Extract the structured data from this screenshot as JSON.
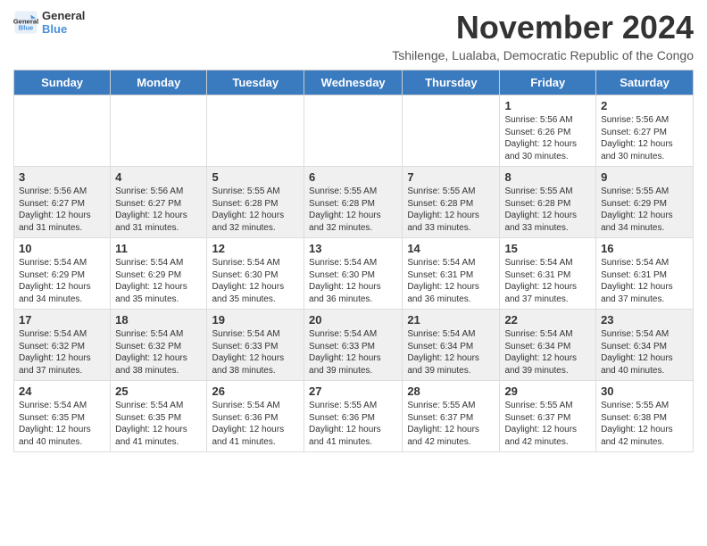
{
  "header": {
    "logo_line1": "General",
    "logo_line2": "Blue",
    "month_title": "November 2024",
    "subtitle": "Tshilenge, Lualaba, Democratic Republic of the Congo"
  },
  "days_of_week": [
    "Sunday",
    "Monday",
    "Tuesday",
    "Wednesday",
    "Thursday",
    "Friday",
    "Saturday"
  ],
  "weeks": [
    [
      {
        "day": "",
        "info": ""
      },
      {
        "day": "",
        "info": ""
      },
      {
        "day": "",
        "info": ""
      },
      {
        "day": "",
        "info": ""
      },
      {
        "day": "",
        "info": ""
      },
      {
        "day": "1",
        "info": "Sunrise: 5:56 AM\nSunset: 6:26 PM\nDaylight: 12 hours and 30 minutes."
      },
      {
        "day": "2",
        "info": "Sunrise: 5:56 AM\nSunset: 6:27 PM\nDaylight: 12 hours and 30 minutes."
      }
    ],
    [
      {
        "day": "3",
        "info": "Sunrise: 5:56 AM\nSunset: 6:27 PM\nDaylight: 12 hours and 31 minutes."
      },
      {
        "day": "4",
        "info": "Sunrise: 5:56 AM\nSunset: 6:27 PM\nDaylight: 12 hours and 31 minutes."
      },
      {
        "day": "5",
        "info": "Sunrise: 5:55 AM\nSunset: 6:28 PM\nDaylight: 12 hours and 32 minutes."
      },
      {
        "day": "6",
        "info": "Sunrise: 5:55 AM\nSunset: 6:28 PM\nDaylight: 12 hours and 32 minutes."
      },
      {
        "day": "7",
        "info": "Sunrise: 5:55 AM\nSunset: 6:28 PM\nDaylight: 12 hours and 33 minutes."
      },
      {
        "day": "8",
        "info": "Sunrise: 5:55 AM\nSunset: 6:28 PM\nDaylight: 12 hours and 33 minutes."
      },
      {
        "day": "9",
        "info": "Sunrise: 5:55 AM\nSunset: 6:29 PM\nDaylight: 12 hours and 34 minutes."
      }
    ],
    [
      {
        "day": "10",
        "info": "Sunrise: 5:54 AM\nSunset: 6:29 PM\nDaylight: 12 hours and 34 minutes."
      },
      {
        "day": "11",
        "info": "Sunrise: 5:54 AM\nSunset: 6:29 PM\nDaylight: 12 hours and 35 minutes."
      },
      {
        "day": "12",
        "info": "Sunrise: 5:54 AM\nSunset: 6:30 PM\nDaylight: 12 hours and 35 minutes."
      },
      {
        "day": "13",
        "info": "Sunrise: 5:54 AM\nSunset: 6:30 PM\nDaylight: 12 hours and 36 minutes."
      },
      {
        "day": "14",
        "info": "Sunrise: 5:54 AM\nSunset: 6:31 PM\nDaylight: 12 hours and 36 minutes."
      },
      {
        "day": "15",
        "info": "Sunrise: 5:54 AM\nSunset: 6:31 PM\nDaylight: 12 hours and 37 minutes."
      },
      {
        "day": "16",
        "info": "Sunrise: 5:54 AM\nSunset: 6:31 PM\nDaylight: 12 hours and 37 minutes."
      }
    ],
    [
      {
        "day": "17",
        "info": "Sunrise: 5:54 AM\nSunset: 6:32 PM\nDaylight: 12 hours and 37 minutes."
      },
      {
        "day": "18",
        "info": "Sunrise: 5:54 AM\nSunset: 6:32 PM\nDaylight: 12 hours and 38 minutes."
      },
      {
        "day": "19",
        "info": "Sunrise: 5:54 AM\nSunset: 6:33 PM\nDaylight: 12 hours and 38 minutes."
      },
      {
        "day": "20",
        "info": "Sunrise: 5:54 AM\nSunset: 6:33 PM\nDaylight: 12 hours and 39 minutes."
      },
      {
        "day": "21",
        "info": "Sunrise: 5:54 AM\nSunset: 6:34 PM\nDaylight: 12 hours and 39 minutes."
      },
      {
        "day": "22",
        "info": "Sunrise: 5:54 AM\nSunset: 6:34 PM\nDaylight: 12 hours and 39 minutes."
      },
      {
        "day": "23",
        "info": "Sunrise: 5:54 AM\nSunset: 6:34 PM\nDaylight: 12 hours and 40 minutes."
      }
    ],
    [
      {
        "day": "24",
        "info": "Sunrise: 5:54 AM\nSunset: 6:35 PM\nDaylight: 12 hours and 40 minutes."
      },
      {
        "day": "25",
        "info": "Sunrise: 5:54 AM\nSunset: 6:35 PM\nDaylight: 12 hours and 41 minutes."
      },
      {
        "day": "26",
        "info": "Sunrise: 5:54 AM\nSunset: 6:36 PM\nDaylight: 12 hours and 41 minutes."
      },
      {
        "day": "27",
        "info": "Sunrise: 5:55 AM\nSunset: 6:36 PM\nDaylight: 12 hours and 41 minutes."
      },
      {
        "day": "28",
        "info": "Sunrise: 5:55 AM\nSunset: 6:37 PM\nDaylight: 12 hours and 42 minutes."
      },
      {
        "day": "29",
        "info": "Sunrise: 5:55 AM\nSunset: 6:37 PM\nDaylight: 12 hours and 42 minutes."
      },
      {
        "day": "30",
        "info": "Sunrise: 5:55 AM\nSunset: 6:38 PM\nDaylight: 12 hours and 42 minutes."
      }
    ]
  ]
}
